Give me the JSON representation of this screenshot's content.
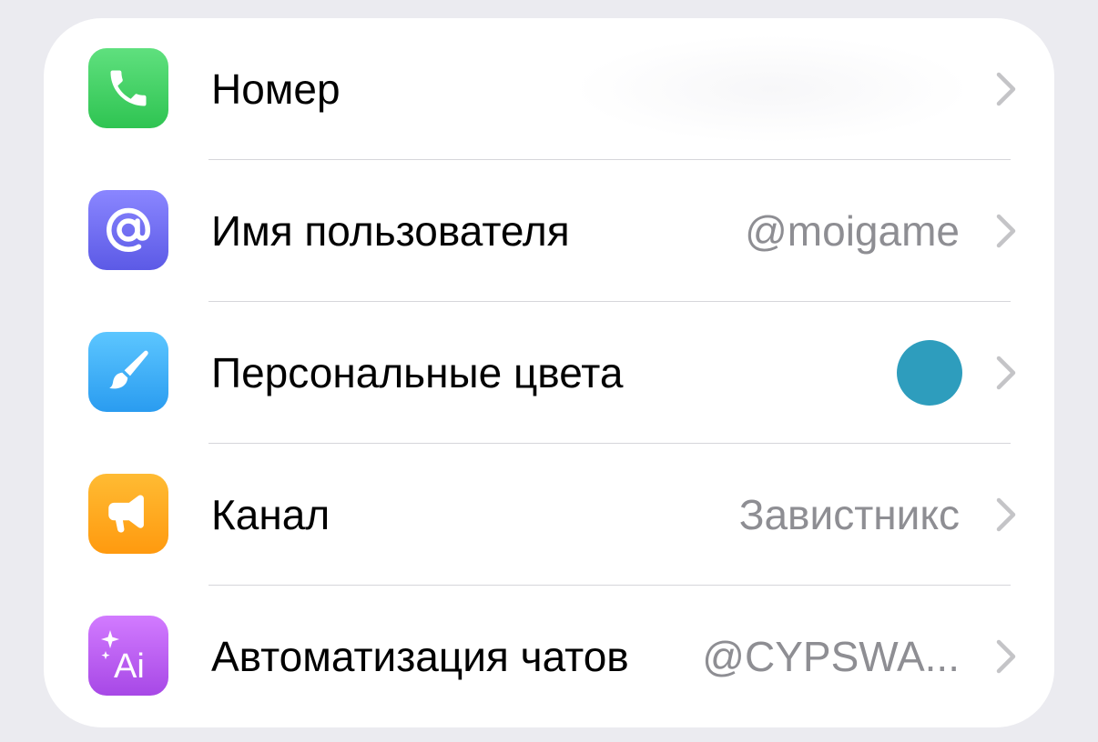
{
  "rows": [
    {
      "label": "Номер",
      "value": "",
      "icon": "phone-icon",
      "icon_color": "#34c759"
    },
    {
      "label": "Имя пользователя",
      "value": "@moigame",
      "icon": "at-sign-icon",
      "icon_color": "#6e6cf2"
    },
    {
      "label": "Персональные цвета",
      "value": "",
      "icon": "paintbrush-icon",
      "icon_color": "#33aaf2",
      "swatch_color": "#2e9dbd"
    },
    {
      "label": "Канал",
      "value": "Завистникс",
      "icon": "megaphone-icon",
      "icon_color": "#ffa31a"
    },
    {
      "label": "Автоматизация чатов",
      "value": "@CYPSWA...",
      "icon": "ai-sparkle-icon",
      "icon_color": "#bf5af2"
    }
  ],
  "colors": {
    "background": "#ebebf0",
    "card": "#ffffff",
    "secondary_text": "#8e8e93",
    "chevron": "#c4c4c7"
  }
}
